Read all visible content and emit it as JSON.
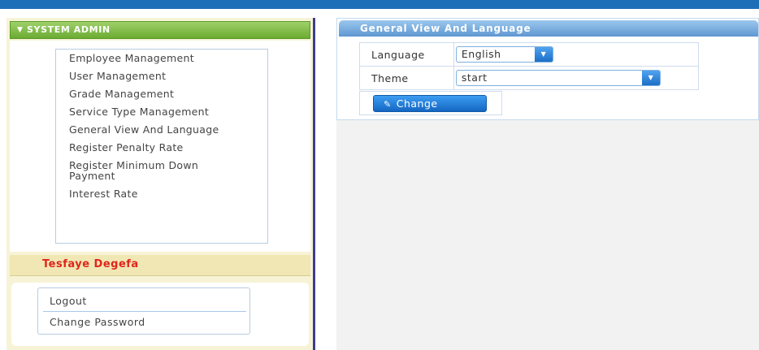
{
  "sidebar": {
    "section_title": "SYSTEM ADMIN",
    "menu": [
      "Employee Management",
      "User Management",
      "Grade Management",
      "Service Type Management",
      "General View And Language",
      "Register Penalty Rate",
      "Register Minimum Down Payment",
      "Interest Rate"
    ],
    "user_name": "Tesfaye Degefa",
    "account": {
      "logout": "Logout",
      "change_password": "Change Password"
    }
  },
  "main": {
    "panel_title": "General View And Language",
    "language_label": "Language",
    "language_value": "English",
    "theme_label": "Theme",
    "theme_value": "start",
    "change_button": "Change"
  },
  "colors": {
    "top_bar": "#1d6fb8",
    "sidebar_header": "#6bab32",
    "user_name": "#e0251b",
    "panel_header": "#5e97d1",
    "button": "#1467c2"
  }
}
